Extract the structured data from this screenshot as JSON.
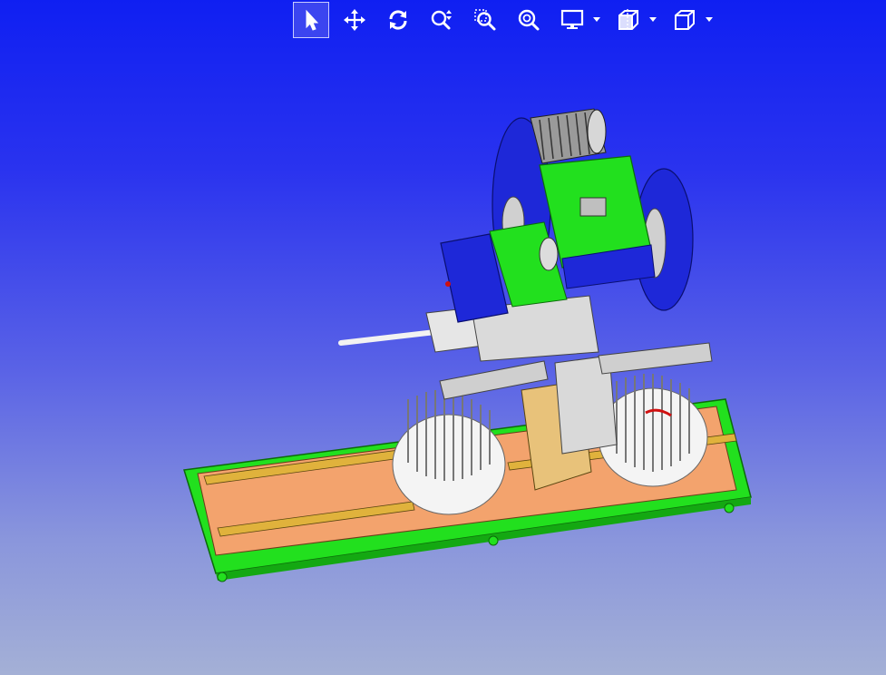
{
  "toolbar": {
    "buttons": [
      {
        "id": "select",
        "icon": "cursor-arrow-icon",
        "active": true
      },
      {
        "id": "pan",
        "icon": "move-arrows-icon",
        "active": false
      },
      {
        "id": "rotate",
        "icon": "rotate-icon",
        "active": false
      },
      {
        "id": "zoom",
        "icon": "zoom-updown-icon",
        "active": false
      },
      {
        "id": "zoom-window",
        "icon": "zoom-box-icon",
        "active": false
      },
      {
        "id": "zoom-fit",
        "icon": "zoom-fit-icon",
        "active": false
      },
      {
        "id": "display",
        "icon": "monitor-icon",
        "dropdown": true
      },
      {
        "id": "section",
        "icon": "section-view-icon",
        "dropdown": true
      },
      {
        "id": "view-cube",
        "icon": "cube-icon",
        "dropdown": true
      }
    ]
  },
  "colors": {
    "background_top": "#0f1ff2",
    "background_bottom": "#a4b0d6",
    "frame_green": "#22e01e",
    "body_blue": "#1e28d8",
    "base_orange": "#f3a36d",
    "rail_yellow": "#e0b23c",
    "metal_grey": "#c7c7c7"
  }
}
